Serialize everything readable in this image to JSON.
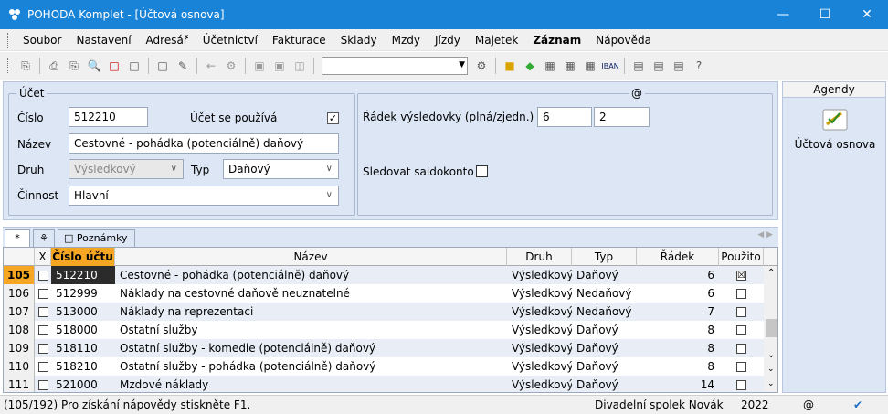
{
  "window": {
    "title": "POHODA Komplet - [Účtová osnova]"
  },
  "menu": [
    "Soubor",
    "Nastavení",
    "Adresář",
    "Účetnictví",
    "Fakturace",
    "Sklady",
    "Mzdy",
    "Jízdy",
    "Majetek",
    "Záznam",
    "Nápověda"
  ],
  "form": {
    "legend_ucet": "Účet",
    "legend_at": "@",
    "cislo_label": "Číslo",
    "cislo_value": "512210",
    "pouziva_label": "Účet se používá",
    "pouziva_checked": "✓",
    "nazev_label": "Název",
    "nazev_value": "Cestovné - pohádka (potenciálně) daňový",
    "druh_label": "Druh",
    "druh_value": "Výsledkový",
    "typ_label": "Typ",
    "typ_value": "Daňový",
    "cinnost_label": "Činnost",
    "cinnost_value": "Hlavní",
    "radek_label": "Řádek výsledovky (plná/zjedn.)",
    "radek_plna": "6",
    "radek_zjedn": "2",
    "saldo_label": "Sledovat saldokonto"
  },
  "agenda": {
    "header": "Agendy",
    "item": "Účtová osnova"
  },
  "tabs": {
    "star": "*",
    "notes": "Poznámky"
  },
  "grid": {
    "headers": {
      "x": "X",
      "cislo": "Číslo účtu",
      "nazev": "Název",
      "druh": "Druh",
      "typ": "Typ",
      "radek": "Řádek",
      "pouzito": "Použito"
    },
    "rows": [
      {
        "n": "105",
        "cislo": "512210",
        "nazev": "Cestovné - pohádka (potenciálně) daňový",
        "druh": "Výsledkový",
        "typ": "Daňový",
        "radek": "6",
        "pouzito": "☒"
      },
      {
        "n": "106",
        "cislo": "512999",
        "nazev": "Náklady na cestovné daňově neuznatelné",
        "druh": "Výsledkový",
        "typ": "Nedaňový",
        "radek": "6",
        "pouzito": ""
      },
      {
        "n": "107",
        "cislo": "513000",
        "nazev": "Náklady na reprezentaci",
        "druh": "Výsledkový",
        "typ": "Nedaňový",
        "radek": "7",
        "pouzito": ""
      },
      {
        "n": "108",
        "cislo": "518000",
        "nazev": "Ostatní služby",
        "druh": "Výsledkový",
        "typ": "Daňový",
        "radek": "8",
        "pouzito": ""
      },
      {
        "n": "109",
        "cislo": "518110",
        "nazev": "Ostatní služby - komedie (potenciálně) daňový",
        "druh": "Výsledkový",
        "typ": "Daňový",
        "radek": "8",
        "pouzito": ""
      },
      {
        "n": "110",
        "cislo": "518210",
        "nazev": "Ostatní služby - pohádka (potenciálně) daňový",
        "druh": "Výsledkový",
        "typ": "Daňový",
        "radek": "8",
        "pouzito": ""
      },
      {
        "n": "111",
        "cislo": "521000",
        "nazev": "Mzdové náklady",
        "druh": "Výsledkový",
        "typ": "Daňový",
        "radek": "14",
        "pouzito": ""
      }
    ]
  },
  "status": {
    "left": "(105/192) Pro získání nápovědy stiskněte F1.",
    "company": "Divadelní spolek Novák",
    "year": "2022",
    "at": "@"
  }
}
